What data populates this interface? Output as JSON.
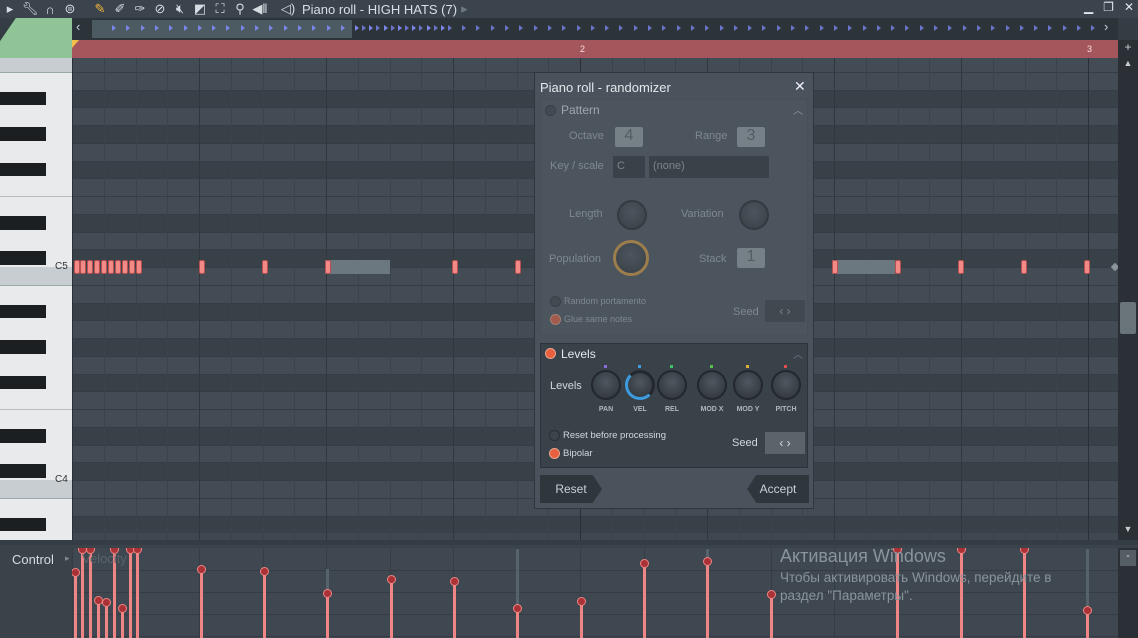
{
  "toolbar": {
    "title": "Piano roll - HIGH HATS (7)",
    "icons": [
      "play-arrow-icon",
      "wrench-icon",
      "magnet-icon",
      "menu-icon",
      "pencil-icon",
      "paint-brush-icon",
      "delete-brush-icon",
      "mute-circle-icon",
      "mute-speaker-icon",
      "slice-icon",
      "select-icon",
      "zoom-icon",
      "playback-icon",
      "speaker-icon"
    ],
    "window": {
      "minimize": "▁",
      "restore": "❐",
      "close": "✕"
    }
  },
  "ruler": {
    "bars": [
      "2",
      "3"
    ]
  },
  "keys": {
    "c5": "C5",
    "c4": "C4"
  },
  "control": {
    "label": "Control",
    "target": "Velocity"
  },
  "dialog": {
    "title": "Piano roll - randomizer",
    "close": "✕",
    "pattern": {
      "header": "Pattern",
      "enabled": false,
      "octave_label": "Octave",
      "octave": "4",
      "range_label": "Range",
      "range": "3",
      "key_label": "Key / scale",
      "key": "C",
      "scale": "(none)",
      "length_label": "Length",
      "variation_label": "Variation",
      "population_label": "Population",
      "stack_label": "Stack",
      "stack": "1",
      "random_portamento": "Random portamento",
      "glue_same_notes": "Glue same notes",
      "seed_label": "Seed"
    },
    "levels": {
      "header": "Levels",
      "enabled": true,
      "row_label": "Levels",
      "knobs": [
        {
          "label": "PAN",
          "color": "#8a6be0"
        },
        {
          "label": "VEL",
          "color": "#3d9be0"
        },
        {
          "label": "REL",
          "color": "#3cc46a"
        },
        {
          "label": "MOD X",
          "color": "#58c04a"
        },
        {
          "label": "MOD Y",
          "color": "#d8b03a"
        },
        {
          "label": "PITCH",
          "color": "#e0504a"
        }
      ],
      "reset_before": "Reset before processing",
      "reset_before_on": false,
      "bipolar": "Bipolar",
      "bipolar_on": true,
      "seed_label": "Seed"
    },
    "reset": "Reset",
    "accept": "Accept"
  },
  "watermark": {
    "title": "Активация Windows",
    "body1": "Чтобы активировать Windows, перейдите в",
    "body2": "раздел \"Параметры\"."
  },
  "colors": {
    "note": "#f28b88",
    "ruler": "#a4565c",
    "accent": "#e8603e"
  }
}
